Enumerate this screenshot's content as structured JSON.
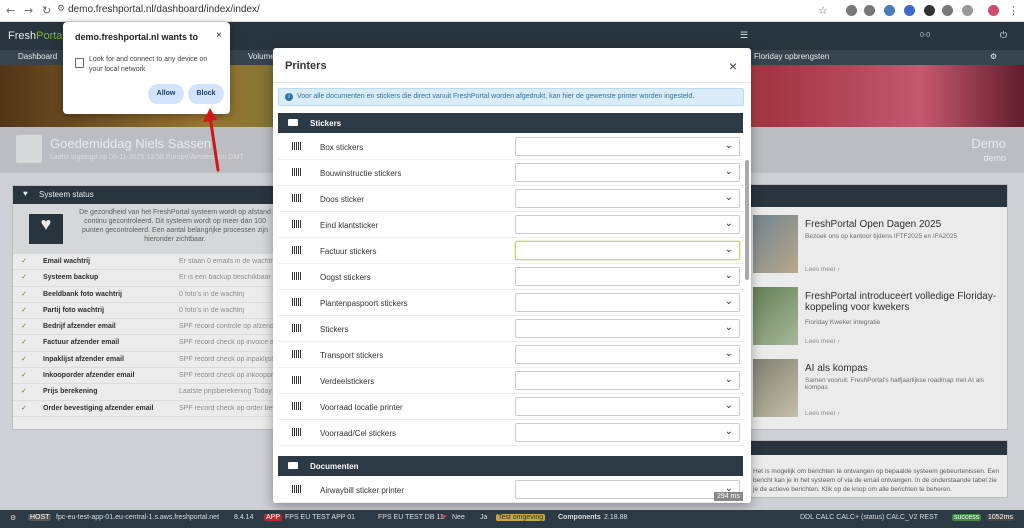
{
  "browser": {
    "url": "demo.freshportal.nl/dashboard/index/index/"
  },
  "app": {
    "logo_main": "Fresh",
    "logo_accent": "Portal",
    "menu": [
      "Dashboard",
      "Volume",
      "Floriday opbrengsten"
    ],
    "header_count": "0-0"
  },
  "banner": {
    "greeting": "Goedemiddag Niels Sassen",
    "subtitle": "Laatst ingelogd op 06-11-2025 13:58 Europe/Amsterdam GMT",
    "company": "Demo",
    "company_sub": "demo"
  },
  "left_panel": {
    "title": "Systeem status",
    "intro": "De gezondheid van het FreshPortal systeem wordt op afstand continu gecontroleerd. Dit systeem wordt op meer dan 100 punten gecontroleerd. Een aantal belangrijke processen zijn hieronder zichtbaar.",
    "rows": [
      {
        "name": "Email wachtrij",
        "desc": "Er staan 0 emails in de wachtrij"
      },
      {
        "name": "Systeem backup",
        "desc": "Er is een backup beschikbaar van vandaag"
      },
      {
        "name": "Beeldbank foto wachtrij",
        "desc": "0 foto's in de wachtrij"
      },
      {
        "name": "Partij foto wachtrij",
        "desc": "0 foto's in de wachtrij"
      },
      {
        "name": "Bedrijf afzender email",
        "desc": "SPF record controle op afzender"
      },
      {
        "name": "Factuur afzender email",
        "desc": "SPF record check op invoice afzender"
      },
      {
        "name": "Inpaklijst afzender email",
        "desc": "SPF record check op inpaklijst afzender"
      },
      {
        "name": "Inkooporder afzender email",
        "desc": "SPF record check op inkooporder afzender"
      },
      {
        "name": "Prijs berekening",
        "desc": "Laatste prijsberekening Today at 13:58"
      },
      {
        "name": "Order bevestiging afzender email",
        "desc": "SPF record check op order bevestiging afzender"
      }
    ]
  },
  "news": [
    {
      "title": "FreshPortal Open Dagen 2025",
      "text": "Bezoek ons op kantoor tijdens IFTF2025 en IFA2025",
      "more": "Lees meer"
    },
    {
      "title": "FreshPortal introduceert volledige Floriday-koppeling voor kwekers",
      "text": "Floriday Kweker integratie",
      "more": "Lees meer"
    },
    {
      "title": "AI als kompas",
      "text": "Samen vooruit: FreshPortal's halfjaarlijkse roadmap met AI als kompas",
      "more": "Lees meer"
    }
  ],
  "notice_text": "Het is mogelijk om berichten te ontvangen op bepaalde systeem gebeurtenissen. Een bericht kan je in het systeem of via de email ontvangen. In de onderstaande tabel zie je de actieve berichten. Klik op de knop om alle berichten te beheren.",
  "modal": {
    "title": "Printers",
    "close": "×",
    "info": "Voor alle documenten en stickers die direct vanuit FreshPortal worden afgedrukt, kan hier de gewenste printer worden ingesteld.",
    "section_stickers": "Stickers",
    "stickers": [
      "Box stickers",
      "Bouwinstructie stickers",
      "Doos sticker",
      "Eind klantsticker",
      "Factuur stickers",
      "Oogst stickers",
      "Plantenpaspoort stickers",
      "Stickers",
      "Transport stickers",
      "Verdeelstickers",
      "Voorraad locatie printer",
      "Voorraad/Cel stickers"
    ],
    "section_documents": "Documenten",
    "documents": [
      "Airwaybill sticker printer"
    ],
    "footer": "294 ms"
  },
  "popup": {
    "title": "demo.freshportal.nl wants to",
    "text": "Look for and connect to any device on your local network",
    "allow": "Allow",
    "block": "Block",
    "close": "×"
  },
  "statusbar": {
    "host_label": "HOST",
    "host": "fpc-eu-test-app-01.eu-central-1.s.aws.freshportal.net",
    "php": "8.4.14",
    "app_label": "APP",
    "app": "FPS EU TEST APP 01",
    "db": "FPS EU TEST DB 11",
    "nee": "Nee",
    "ja": "Ja",
    "tag": "Test omgeving",
    "components": "Components",
    "version": "2.18.88",
    "ddl": "DDL CALC CALC+ (status) CALC_V2 REST",
    "badge1": "success",
    "badge2": "1052ms"
  }
}
